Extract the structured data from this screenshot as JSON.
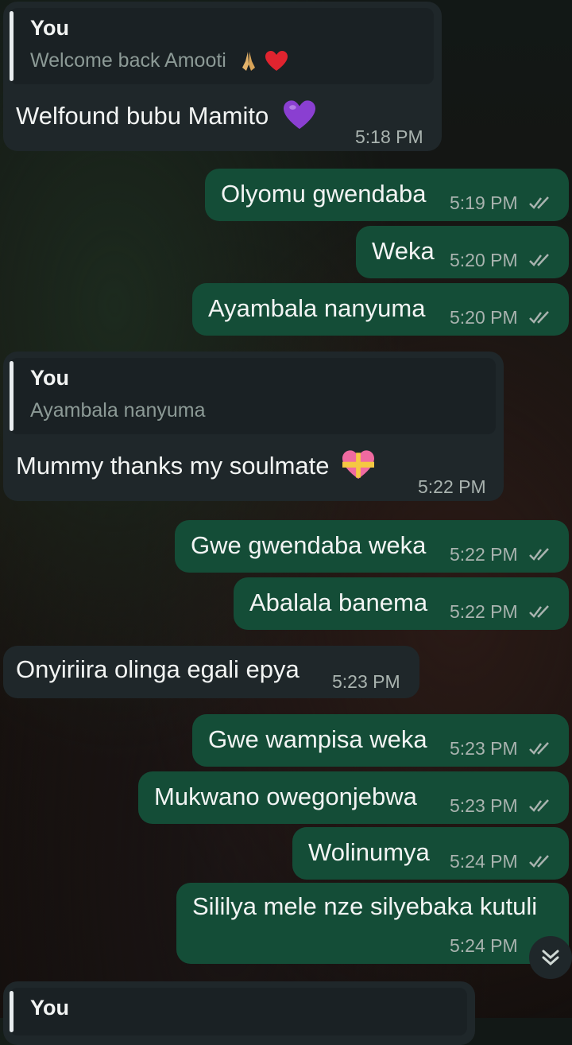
{
  "messages": [
    {
      "text": "Welfound bubu Mamito",
      "time": "5:18 PM",
      "quote": {
        "author": "You",
        "text": "Welcome back Amooti"
      }
    },
    {
      "text": "Olyomu gwendaba",
      "time": "5:19 PM"
    },
    {
      "text": "Weka",
      "time": "5:20 PM"
    },
    {
      "text": "Ayambala nanyuma",
      "time": "5:20 PM"
    },
    {
      "text": "Mummy thanks my soulmate",
      "time": "5:22 PM",
      "quote": {
        "author": "You",
        "text": "Ayambala nanyuma"
      }
    },
    {
      "text": "Gwe gwendaba weka",
      "time": "5:22 PM"
    },
    {
      "text": "Abalala banema",
      "time": "5:22 PM"
    },
    {
      "text": "Onyiriira olinga egali epya",
      "time": "5:23 PM"
    },
    {
      "text": "Gwe wampisa weka",
      "time": "5:23 PM"
    },
    {
      "text": "Mukwano owegonjebwa",
      "time": "5:23 PM"
    },
    {
      "text": "Wolinumya",
      "time": "5:24 PM"
    },
    {
      "text": "Sililya mele nze silyebaka kutuli",
      "time": "5:24 PM"
    }
  ],
  "partial_next": {
    "quote_author": "You"
  },
  "colors": {
    "incoming_bubble": "#1f272a",
    "outgoing_bubble": "#144d37",
    "read_ticks": "#a9b3af"
  },
  "icons": [
    "praying-hands-emoji",
    "red-heart-emoji",
    "purple-heart-emoji",
    "heart-ribbon-emoji",
    "double-check-icon",
    "scroll-down-icon"
  ]
}
